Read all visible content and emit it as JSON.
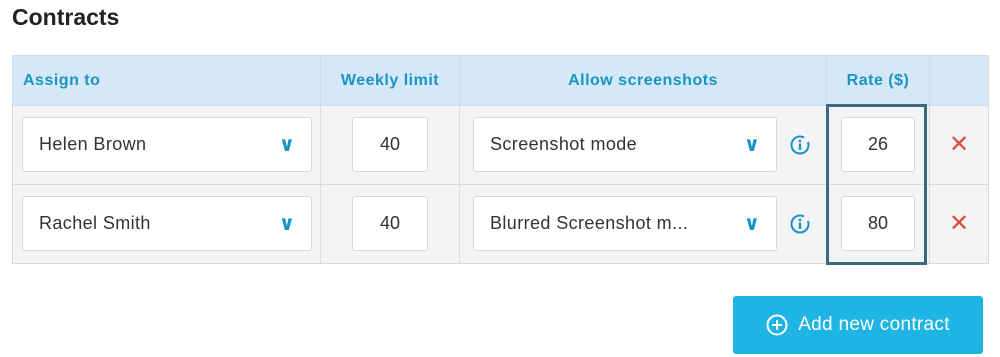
{
  "title": "Contracts",
  "columns": {
    "assign_to": "Assign to",
    "weekly_limit": "Weekly limit",
    "allow_screenshots": "Allow screenshots",
    "rate": "Rate ($)"
  },
  "rows": [
    {
      "assignee": "Helen Brown",
      "weekly_limit": "40",
      "screenshot_mode": "Screenshot mode",
      "rate": "26"
    },
    {
      "assignee": "Rachel Smith",
      "weekly_limit": "40",
      "screenshot_mode": "Blurred Screenshot m...",
      "rate": "80"
    }
  ],
  "add_button_label": "Add new contract",
  "icons": {
    "dropdown": "chevron-down-icon",
    "info": "info-icon",
    "delete": "close-icon",
    "add": "plus-circle-icon"
  },
  "colors": {
    "accent": "#1a94c4",
    "header_bg": "#d5e8f7",
    "delete": "#e04c3c",
    "button_bg": "#1eb4e4",
    "highlight_border": "#3b6a7c"
  }
}
